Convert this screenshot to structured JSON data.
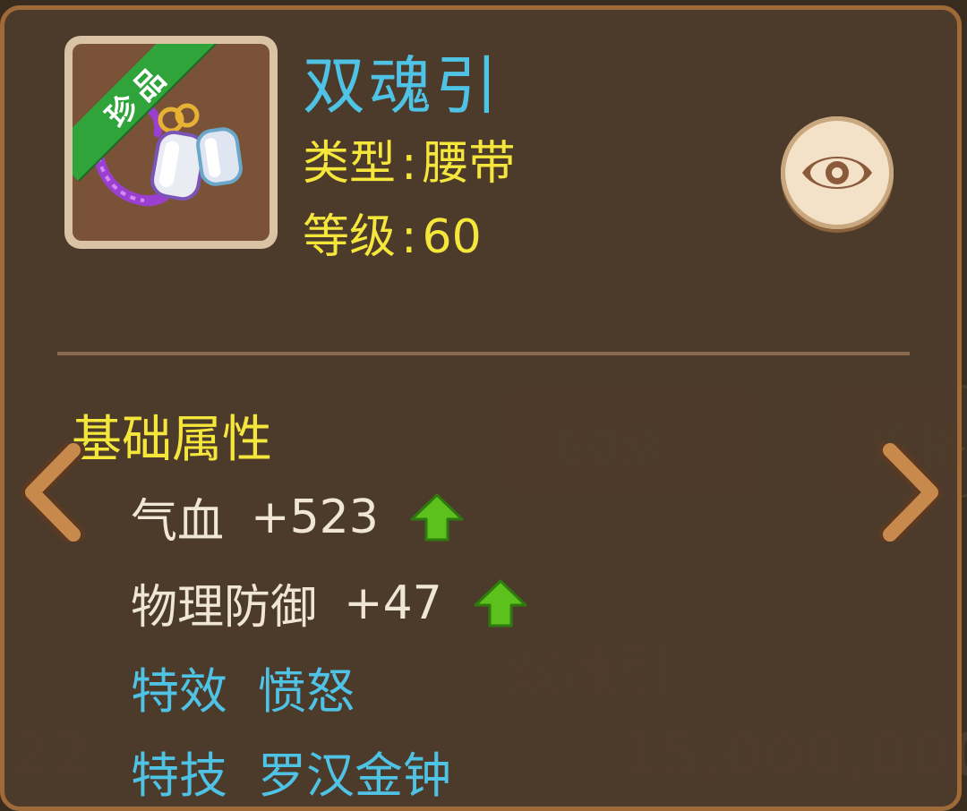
{
  "item": {
    "name": "双魂引",
    "rarity_badge": "珍品",
    "type_label": "类型",
    "type_value": "腰带",
    "level_label": "等级",
    "level_value": "60",
    "colon": ":",
    "icon": "waist-belt-charm-icon"
  },
  "attributes": {
    "section_title": "基础属性",
    "rows": [
      {
        "name": "气血",
        "value": "+523",
        "trend": "up"
      },
      {
        "name": "物理防御",
        "value": "+47",
        "trend": "up"
      }
    ]
  },
  "specials": [
    {
      "label": "特效",
      "value": "愤怒"
    },
    {
      "label": "特技",
      "value": "罗汉金钟"
    }
  ],
  "colors": {
    "name": "#4fc3e6",
    "label_yellow": "#f5e63c",
    "up_arrow": "#5cc11d",
    "rarity_green": "#2fa43b"
  }
}
